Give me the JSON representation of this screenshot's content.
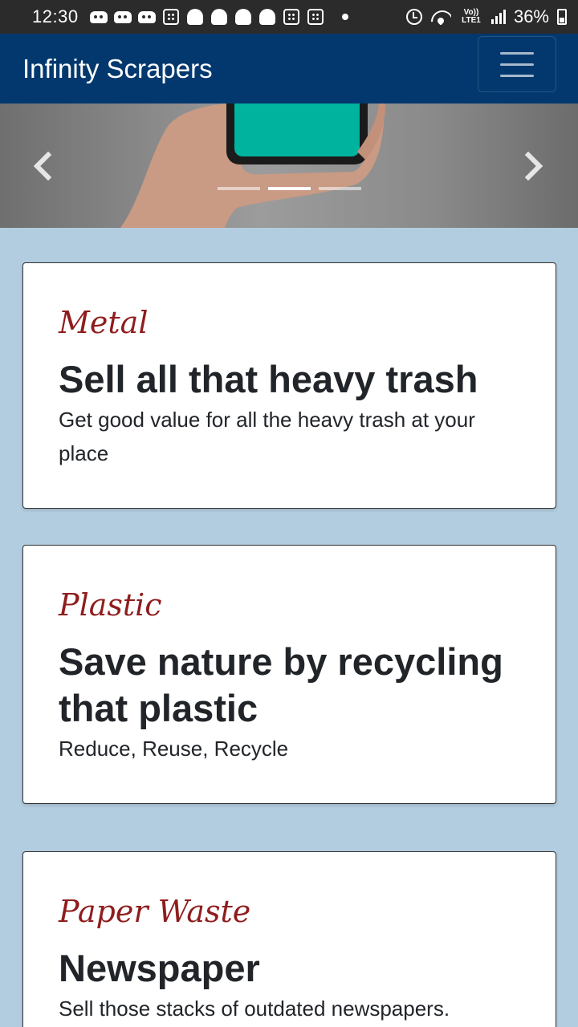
{
  "status_bar": {
    "time": "12:30",
    "lte_label": "Vo)) LTE1",
    "battery_percent": "36%"
  },
  "navbar": {
    "brand": "Infinity Scrapers"
  },
  "carousel": {
    "slide_count": 3,
    "active_slide": 2
  },
  "cards": [
    {
      "kicker": "Metal",
      "title": "Sell all that heavy trash",
      "text": "Get good value for all the heavy trash at your place"
    },
    {
      "kicker": "Plastic",
      "title": "Save nature by recycling that plastic",
      "text": "Reduce, Reuse, Recycle"
    },
    {
      "kicker": "Paper Waste",
      "title": "Newspaper",
      "text": "Sell those stacks of outdated newspapers."
    }
  ],
  "colors": {
    "page_background": "#b3cde0",
    "navbar": "#02386e",
    "kicker": "#8f1d1d",
    "phone_screen": "#00b39f"
  }
}
